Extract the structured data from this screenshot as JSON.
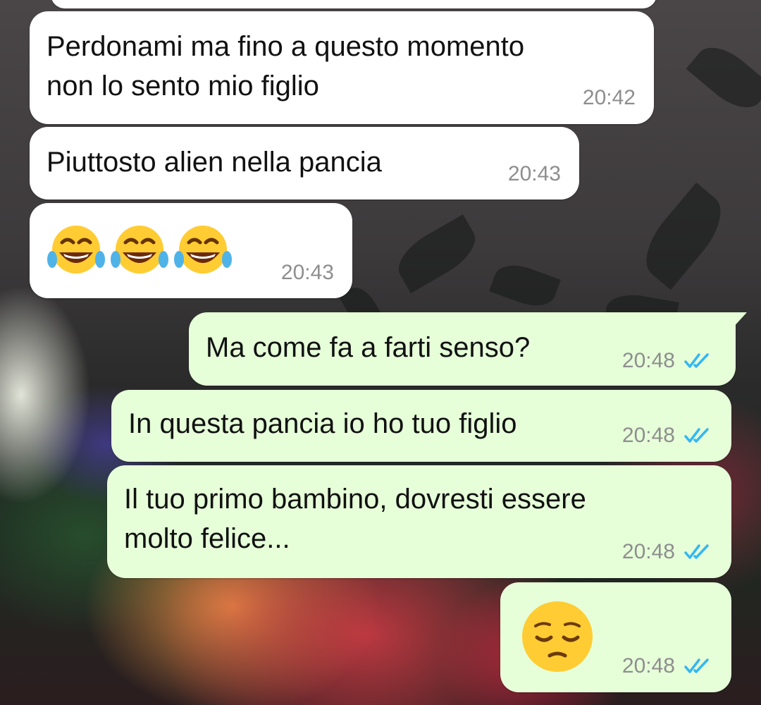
{
  "messages": [
    {
      "id": "msg1",
      "direction": "incoming",
      "text": "Perdonami ma fino a questo momento\nnon lo sento mio figlio",
      "time": "20:42"
    },
    {
      "id": "msg2",
      "direction": "incoming",
      "text": "Piuttosto alien nella pancia",
      "time": "20:43"
    },
    {
      "id": "msg3",
      "direction": "incoming",
      "emoji": [
        "face-with-tears-of-joy",
        "face-with-tears-of-joy",
        "face-with-tears-of-joy"
      ],
      "time": "20:43"
    },
    {
      "id": "msg4",
      "direction": "outgoing",
      "text": "Ma come fa a farti senso?",
      "time": "20:48",
      "status": "read"
    },
    {
      "id": "msg5",
      "direction": "outgoing",
      "text": "In questa pancia io ho tuo figlio",
      "time": "20:48",
      "status": "read"
    },
    {
      "id": "msg6",
      "direction": "outgoing",
      "text": "Il tuo primo bambino, dovresti essere\nmolto felice...",
      "time": "20:48",
      "status": "read"
    },
    {
      "id": "msg7",
      "direction": "outgoing",
      "emoji": [
        "pensive-face"
      ],
      "time": "20:48",
      "status": "read"
    }
  ],
  "colors": {
    "incoming_bubble": "#ffffff",
    "outgoing_bubble": "#e6ffd9",
    "timestamp": "#8e8e8e",
    "read_ticks": "#34b7f1"
  }
}
